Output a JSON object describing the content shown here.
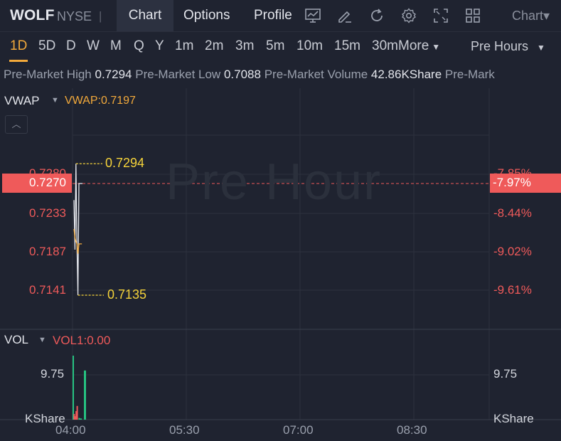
{
  "header": {
    "ticker": "WOLF",
    "exchange": "NYSE",
    "separator": "|",
    "tabs": [
      "Chart",
      "Options",
      "Profile"
    ],
    "active_tab": "Chart",
    "chart_menu_label": "Chart▾"
  },
  "periods": {
    "items": [
      "1D",
      "5D",
      "D",
      "W",
      "M",
      "Q",
      "Y",
      "1m",
      "2m",
      "3m",
      "5m",
      "10m",
      "15m",
      "30m"
    ],
    "selected": "1D",
    "more_label": "More",
    "session_label": "Pre Hours"
  },
  "stats": {
    "high_label": "Pre-Market High",
    "high_value": "0.7294",
    "low_label": "Pre-Market Low",
    "low_value": "0.7088",
    "volume_label": "Pre-Market Volume",
    "volume_value": "42.86KShare",
    "trailing": "Pre-Mark"
  },
  "indicator": {
    "name": "VWAP",
    "value_text": "VWAP:0.7197"
  },
  "price_pane": {
    "watermark": "Pre Hour",
    "current_price": "0.7270",
    "current_pct": "-7.97%",
    "top_price_partial": "0.7280",
    "top_pct_partial": "-7.85%",
    "price_labels": [
      "0.7233",
      "0.7187",
      "0.7141"
    ],
    "pct_labels": [
      "-8.44%",
      "-9.02%",
      "-9.61%"
    ],
    "high_marker": "0.7294",
    "low_marker": "0.7135",
    "price_color": "#ef5a5a",
    "vwap_color": "#f2a93b",
    "marker_color": "#f5d33a"
  },
  "volume_pane": {
    "name": "VOL",
    "value_text": "VOL1:0.00",
    "left_value": "9.75",
    "right_value": "9.75",
    "left_unit": "KShare",
    "right_unit": "KShare",
    "up_color": "#26c281",
    "down_color": "#ef5a5a"
  },
  "time_axis": [
    "04:00",
    "05:30",
    "07:00",
    "08:30"
  ],
  "chart_data": {
    "type": "line",
    "x": [
      "04:00",
      "04:01",
      "04:02",
      "04:03",
      "04:04",
      "04:05",
      "04:06",
      "04:07",
      "04:08"
    ],
    "series": [
      {
        "values": [
          0.725,
          0.719,
          0.7294,
          0.72,
          0.7135,
          0.727,
          0.727,
          0.727,
          0.727
        ]
      },
      {
        "name": "VWAP",
        "values": [
          0.7215,
          0.7205,
          0.72,
          0.7197,
          0.7185,
          0.7197,
          0.7197,
          0.7197,
          0.7197
        ]
      }
    ],
    "volume": {
      "values": [
        11.2,
        1.0,
        0.6,
        1.5,
        2.4,
        8.6,
        0.3,
        0.2,
        0.2
      ],
      "unit": "KShare"
    },
    "ylim": [
      0.711,
      0.731
    ],
    "grid": true
  }
}
